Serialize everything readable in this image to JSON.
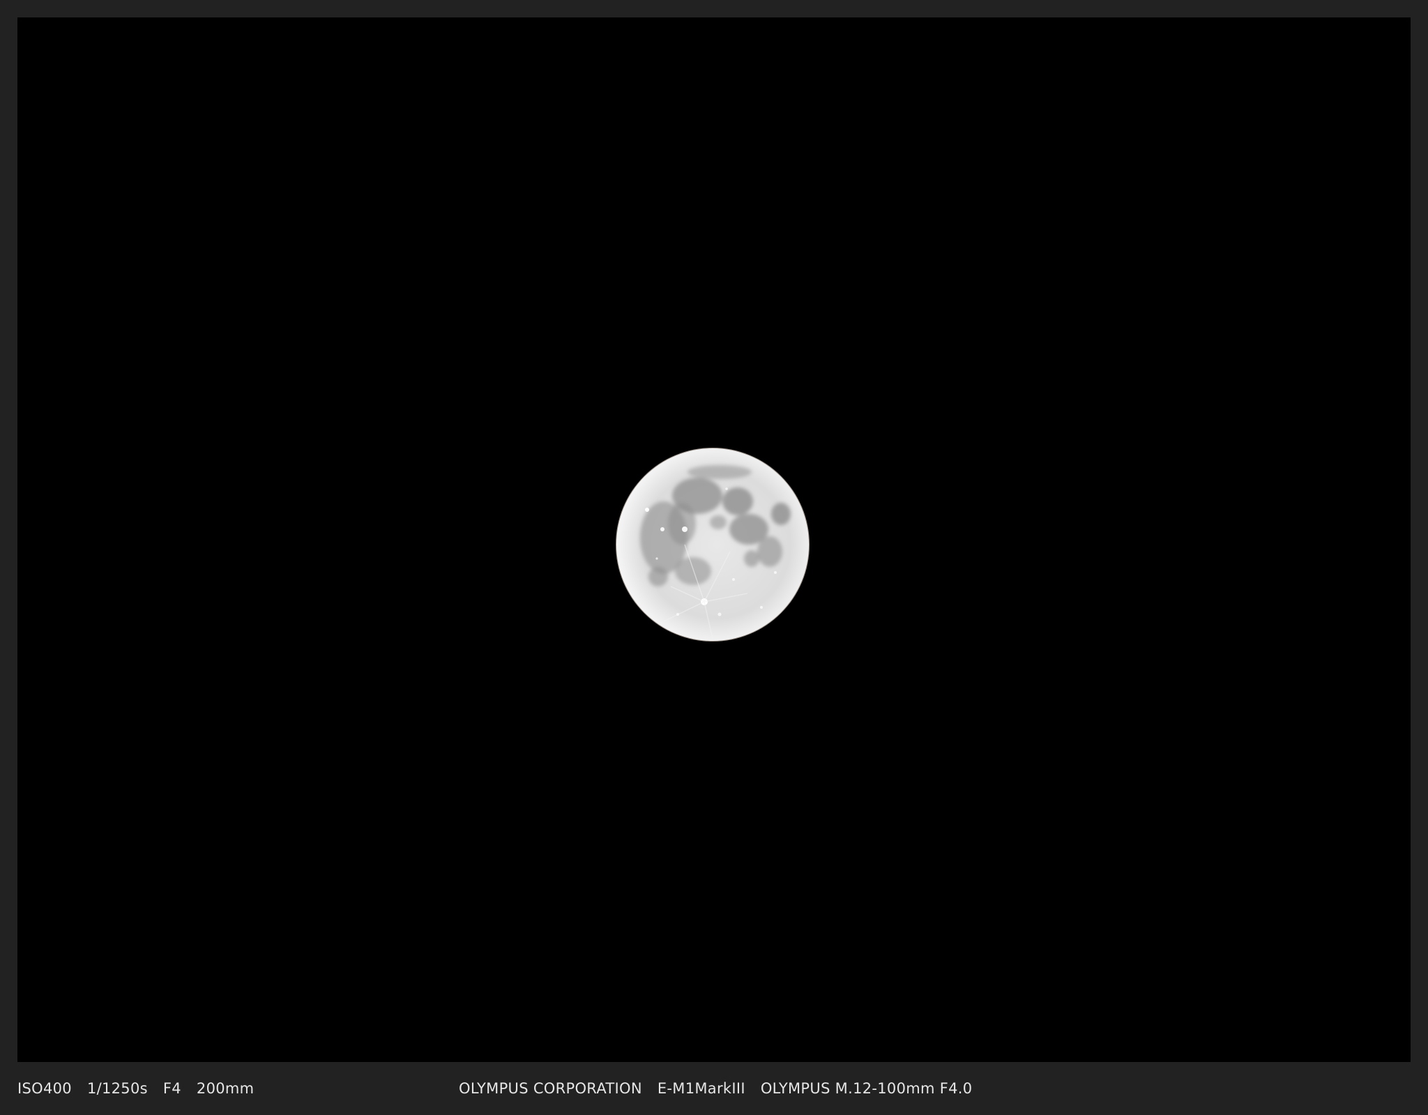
{
  "photo": {
    "subject": "full-moon",
    "background_color": "#000000",
    "frame_color": "#222222"
  },
  "exif": {
    "iso": "ISO400",
    "shutter": "1/1250s",
    "aperture": "F4",
    "focal_length": "200mm",
    "maker": "OLYMPUS CORPORATION",
    "camera": "E-M1MarkIII",
    "lens": "OLYMPUS M.12-100mm F4.0"
  }
}
